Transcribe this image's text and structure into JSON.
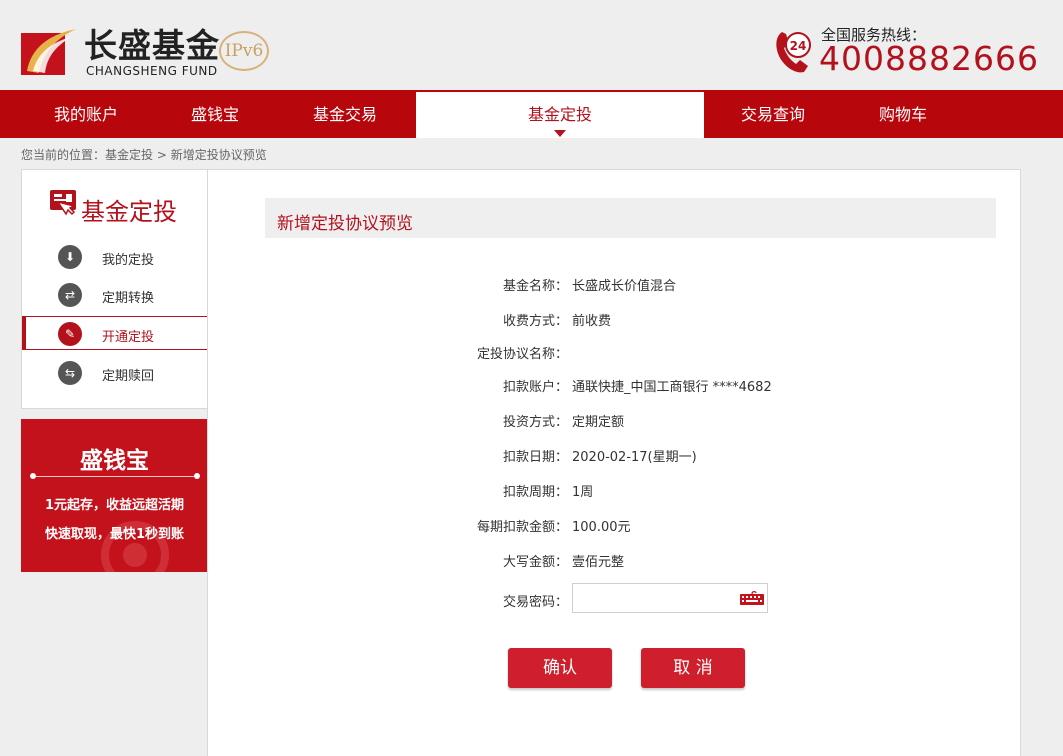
{
  "brand": {
    "name_cn": "长盛基金",
    "name_en": "CHANGSHENG FUND",
    "badge": "IPv6",
    "hotline_label": "全国服务热线：",
    "hotline_number": "4008882666",
    "hotline_icon_text": "24",
    "brand_color": "#b3121c"
  },
  "nav": {
    "items": [
      {
        "label": "我的账户"
      },
      {
        "label": "盛钱宝"
      },
      {
        "label": "基金交易"
      },
      {
        "label": "基金定投",
        "active": true
      },
      {
        "label": "交易查询"
      },
      {
        "label": "购物车"
      }
    ]
  },
  "breadcrumb": {
    "prefix": "您当前的位置：",
    "link": "基金定投",
    "separator": ">",
    "current": "新增定投协议预览"
  },
  "sidebar": {
    "title": "基金定投",
    "items": [
      {
        "label": "我的定投",
        "icon": "download-icon"
      },
      {
        "label": "定期转换",
        "icon": "exchange-icon"
      },
      {
        "label": "开通定投",
        "icon": "form-icon",
        "active": true
      },
      {
        "label": "定期赎回",
        "icon": "redeem-icon"
      }
    ]
  },
  "promo": {
    "title": "盛钱宝",
    "line1": "1元起存，收益远超活期",
    "line2": "快速取现，最快1秒到账"
  },
  "main": {
    "title": "新增定投协议预览",
    "fields": [
      {
        "label": "基金名称：",
        "value": "长盛成长价值混合"
      },
      {
        "label": "收费方式：",
        "value": "前收费"
      },
      {
        "label": "定投协议名称：",
        "value": ""
      },
      {
        "label": "扣款账户：",
        "value": "通联快捷_中国工商银行 ****4682"
      },
      {
        "label": "投资方式：",
        "value": "定期定额"
      },
      {
        "label": "扣款日期：",
        "value": "2020-02-17(星期一)"
      },
      {
        "label": "扣款周期：",
        "value": "1周"
      },
      {
        "label": "每期扣款金额：",
        "value": "100.00元"
      },
      {
        "label": "大写金额：",
        "value": "壹佰元整"
      }
    ],
    "password_label": "交易密码：",
    "password_value": "",
    "confirm_label": "确认",
    "cancel_label": "取 消"
  }
}
